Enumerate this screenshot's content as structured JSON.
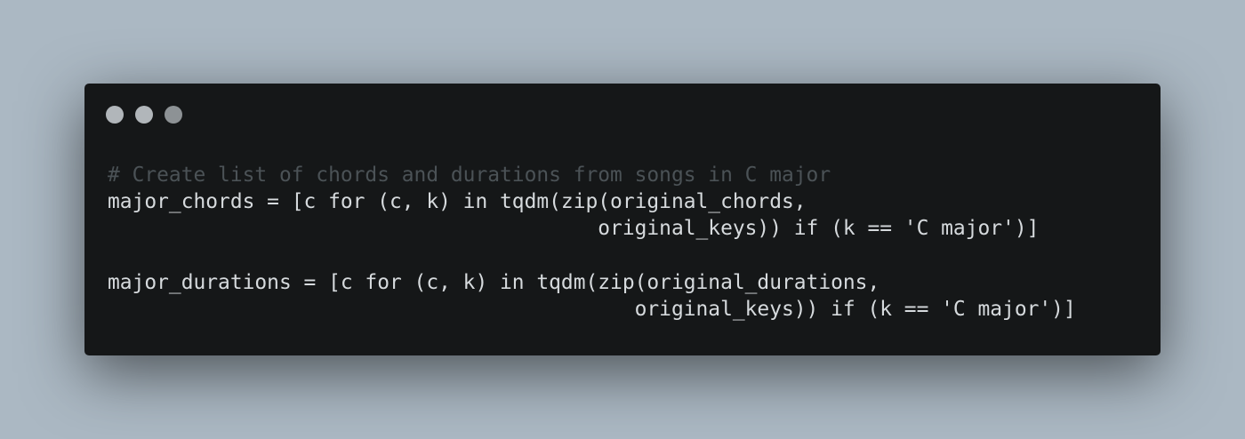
{
  "window": {
    "controls": [
      {
        "name": "close",
        "color": "#b1b6ba"
      },
      {
        "name": "minimize",
        "color": "#b1b6ba"
      },
      {
        "name": "zoom",
        "color": "#8d9295"
      }
    ]
  },
  "code": {
    "lines": [
      {
        "text": "# Create list of chords and durations from songs in C major",
        "kind": "comment"
      },
      {
        "text": "major_chords = [c for (c, k) in tqdm(zip(original_chords,",
        "kind": "code"
      },
      {
        "text": "                                        original_keys)) if (k == 'C major')]",
        "kind": "code"
      },
      {
        "text": "",
        "kind": "blank"
      },
      {
        "text": "major_durations = [c for (c, k) in tqdm(zip(original_durations,",
        "kind": "code"
      },
      {
        "text": "                                           original_keys)) if (k == 'C major')]",
        "kind": "code"
      }
    ]
  },
  "colors": {
    "background": "#abb8c3",
    "window": "#151718",
    "code_text": "#d6dadd",
    "comment_text": "#4b5256"
  }
}
